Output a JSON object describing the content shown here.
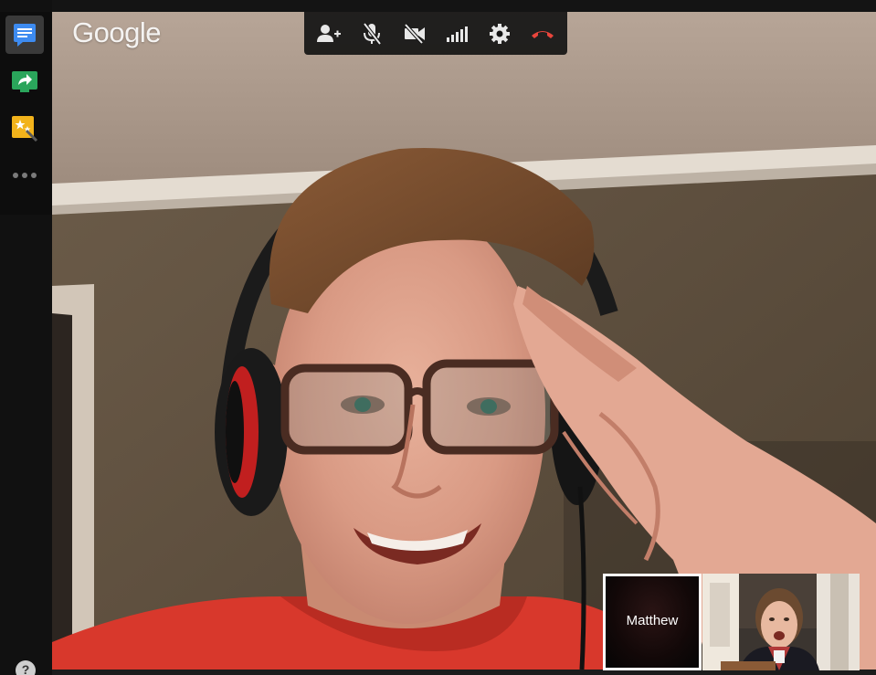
{
  "app": {
    "logo_text": "Google"
  },
  "sidebar": {
    "items": [
      {
        "name": "chat",
        "icon": "chat-icon",
        "active": true
      },
      {
        "name": "screenshare",
        "icon": "screenshare-icon",
        "active": false
      },
      {
        "name": "effects",
        "icon": "effects-icon",
        "active": false
      },
      {
        "name": "more",
        "icon": "more-dots-icon",
        "active": false
      }
    ],
    "help_label": "?"
  },
  "toolbar": {
    "buttons": [
      {
        "name": "invite-people",
        "icon": "add-person-icon"
      },
      {
        "name": "mute-microphone",
        "icon": "microphone-off-icon"
      },
      {
        "name": "turn-off-camera",
        "icon": "camera-off-icon"
      },
      {
        "name": "bandwidth",
        "icon": "signal-bars-icon"
      },
      {
        "name": "settings",
        "icon": "gear-icon"
      },
      {
        "name": "hang-up",
        "icon": "hang-up-icon"
      }
    ],
    "hangup_color": "#e8453c"
  },
  "participants": [
    {
      "name": "Matthew",
      "selected": true,
      "video": false
    },
    {
      "name": "",
      "selected": false,
      "video": true
    }
  ]
}
